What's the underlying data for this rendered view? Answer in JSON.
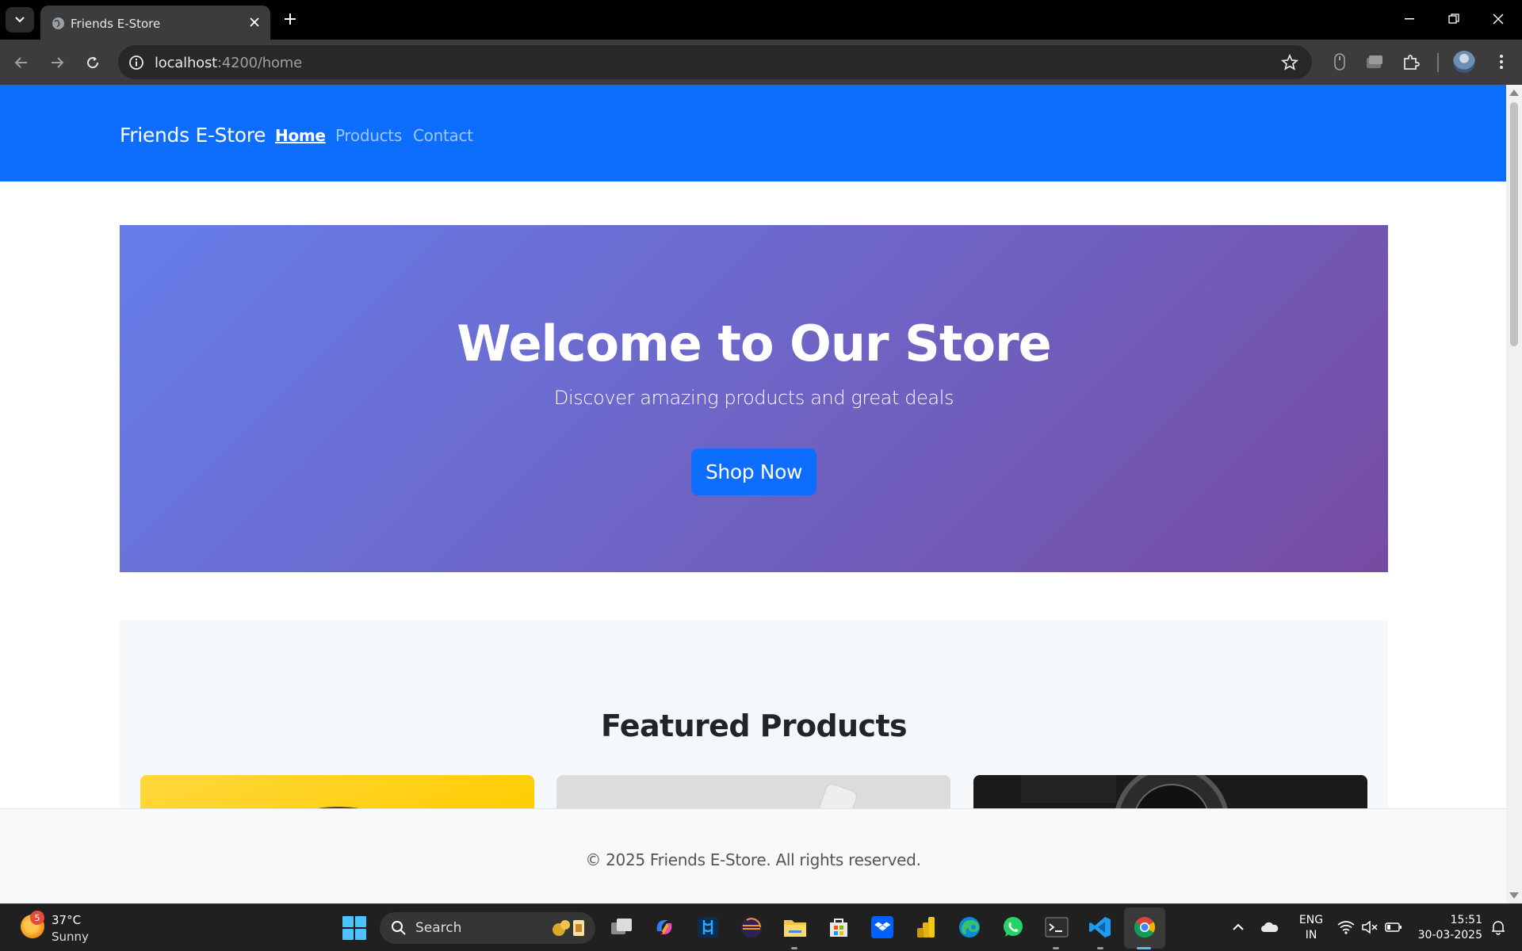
{
  "browser": {
    "tab_title": "Friends E-Store",
    "url_host": "localhost",
    "url_path": ":4200/home"
  },
  "site": {
    "brand": "Friends E-Store",
    "nav": [
      {
        "label": "Home",
        "active": true
      },
      {
        "label": "Products",
        "active": false
      },
      {
        "label": "Contact",
        "active": false
      }
    ],
    "hero": {
      "title": "Welcome to Our Store",
      "subtitle": "Discover amazing products and great deals",
      "button": "Shop Now"
    },
    "featured": {
      "title": "Featured Products"
    },
    "footer": "© 2025 Friends E-Store. All rights reserved."
  },
  "colors": {
    "navbar": "#0d6efd",
    "hero_start": "#667eea",
    "hero_end": "#764ba2",
    "button": "#0d6efd"
  },
  "taskbar": {
    "weather_badge": "5",
    "weather_temp": "37°C",
    "weather_condition": "Sunny",
    "search_label": "Search",
    "lang_line1": "ENG",
    "lang_line2": "IN",
    "time": "15:51",
    "date": "30-03-2025",
    "apps": [
      "task-view-icon",
      "copilot-icon",
      "azure-data-studio-icon",
      "eclipse-icon",
      "file-explorer-icon",
      "microsoft-store-icon",
      "dropbox-icon",
      "power-bi-icon",
      "edge-icon",
      "whatsapp-icon",
      "terminal-icon",
      "vscode-icon",
      "chrome-icon"
    ]
  }
}
